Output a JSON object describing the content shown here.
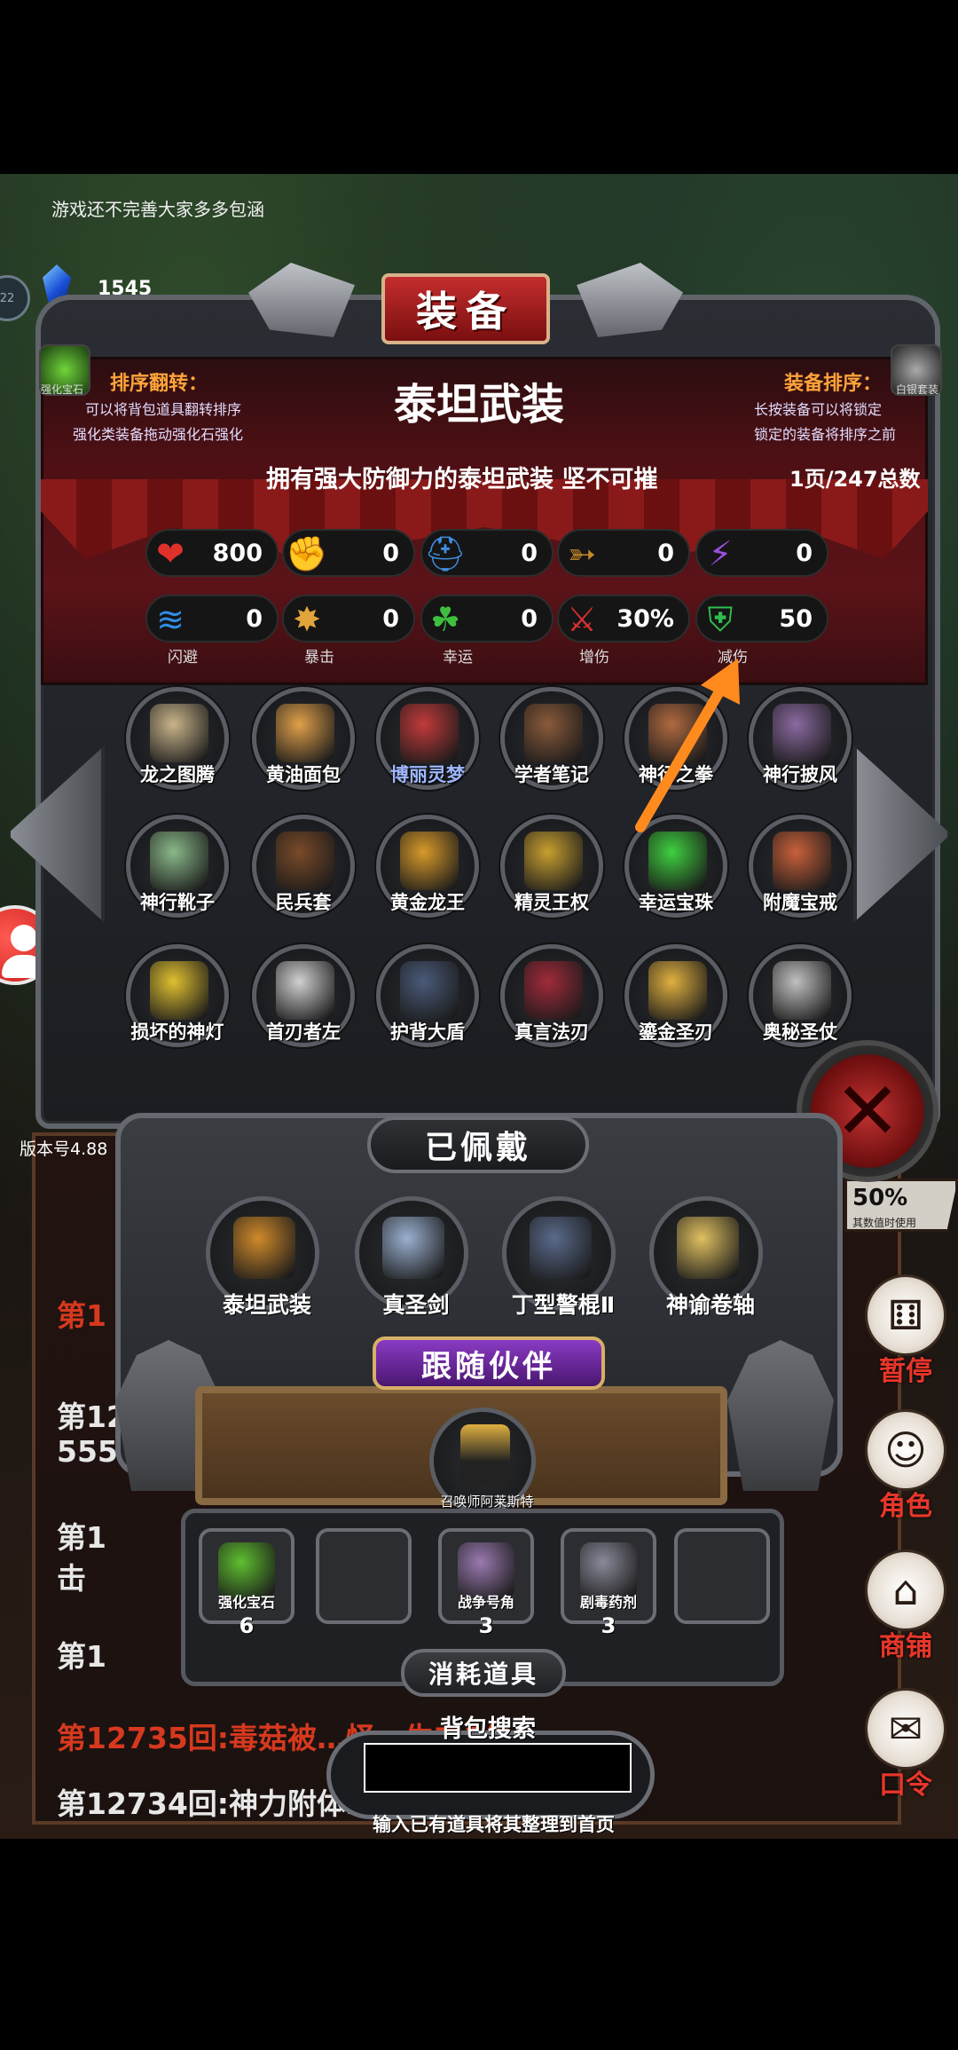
{
  "notice": "游戏还不完善大家多多包涵",
  "currency": {
    "label": "宝石",
    "value": "1545",
    "side_badge": "22"
  },
  "version": "版本号4.88",
  "window_title": "装备",
  "corner_left": {
    "label": "强化宝石"
  },
  "corner_right": {
    "label": "白银套装"
  },
  "hint_left": {
    "title": "排序翻转：",
    "line1": "可以将背包道具翻转排序",
    "line2": "强化类装备拖动强化石强化"
  },
  "hint_right": {
    "title": "装备排序：",
    "line1": "长按装备可以将锁定",
    "line2": "锁定的装备将排序之前"
  },
  "item": {
    "name": "泰坦武装",
    "description": "拥有强大防御力的泰坦武装 坚不可摧",
    "page_info": "1页/247总数"
  },
  "stats_row1": [
    {
      "icon": "heart-icon",
      "value": "800",
      "color": "#e0302a"
    },
    {
      "icon": "muscle-icon",
      "value": "0",
      "color": "#e8c23a"
    },
    {
      "icon": "helmet-icon",
      "value": "0",
      "color": "#3f8de0"
    },
    {
      "icon": "bow-icon",
      "value": "0",
      "color": "#c98a2a"
    },
    {
      "icon": "lightning-icon",
      "value": "0",
      "color": "#9b4fe0"
    }
  ],
  "stats_row2": [
    {
      "icon": "dodge-icon",
      "value": "0",
      "label": "闪避",
      "color": "#2f8de8"
    },
    {
      "icon": "crit-icon",
      "value": "0",
      "label": "暴击",
      "color": "#e0a43a"
    },
    {
      "icon": "clover-icon",
      "value": "0",
      "label": "幸运",
      "color": "#3fbf3f"
    },
    {
      "icon": "crossed-swords-icon",
      "value": "30%",
      "label": "增伤",
      "color": "#d83030"
    },
    {
      "icon": "shield-icon",
      "value": "50",
      "label": "减伤",
      "color": "#2fbf4f"
    }
  ],
  "inventory": [
    {
      "name": "龙之图腾",
      "color": "#c9b48a"
    },
    {
      "name": "黄油面包",
      "color": "#e0a04a"
    },
    {
      "name": "博丽灵梦",
      "color": "#c23a3a",
      "name_color": "#9fb7ff"
    },
    {
      "name": "学者笔记",
      "color": "#8a5a3a"
    },
    {
      "name": "神行之拳",
      "color": "#b06a40"
    },
    {
      "name": "神行披风",
      "color": "#8a6aa0"
    },
    {
      "name": "神行靴子",
      "color": "#8ab88a"
    },
    {
      "name": "民兵套",
      "color": "#7a4a28"
    },
    {
      "name": "黄金龙王",
      "color": "#d89a2a"
    },
    {
      "name": "精灵王权",
      "color": "#c8a030"
    },
    {
      "name": "幸运宝珠",
      "color": "#3fcf3f"
    },
    {
      "name": "附魔宝戒",
      "color": "#c8603a"
    },
    {
      "name": "损坏的神灯",
      "color": "#e0c030"
    },
    {
      "name": "首刃者左",
      "color": "#d0d0d0"
    },
    {
      "name": "护背大盾",
      "color": "#4a5a78"
    },
    {
      "name": "真言法刃",
      "color": "#a02a3a"
    },
    {
      "name": "鎏金圣刃",
      "color": "#e0b040"
    },
    {
      "name": "奥秘圣仗",
      "color": "#c0c0c0"
    }
  ],
  "worn": {
    "title": "已佩戴",
    "items": [
      {
        "name": "泰坦武装",
        "color": "#d08a2a"
      },
      {
        "name": "真圣剑",
        "color": "#9ab0d0"
      },
      {
        "name": "丁型警棍Ⅱ",
        "color": "#5a6a8a"
      },
      {
        "name": "神谕卷轴",
        "color": "#e0c060"
      }
    ]
  },
  "companion": {
    "title": "跟随伙伴",
    "name": "召唤师阿莱斯特"
  },
  "consumables": {
    "title": "消耗道具",
    "items": [
      {
        "name": "强化宝石",
        "qty": "6",
        "color": "#5fbf2f"
      },
      {
        "name": "",
        "qty": "",
        "color": ""
      },
      {
        "name": "战争号角",
        "qty": "3",
        "color": "#9a7ab0"
      },
      {
        "name": "剧毒药剂",
        "qty": "3",
        "color": "#8a8a9a"
      },
      {
        "name": "",
        "qty": "",
        "color": ""
      }
    ]
  },
  "search": {
    "label": "背包搜索",
    "placeholder": "",
    "hint": "输入已有道具将其整理到首页"
  },
  "right_badge": {
    "value": "50%",
    "sub": "其数值时使用"
  },
  "actions": [
    {
      "label": "暂停",
      "icon": "dice-icon",
      "glyph": "⚅"
    },
    {
      "label": "角色",
      "icon": "hooded-figure-icon",
      "glyph": "☺"
    },
    {
      "label": "商铺",
      "icon": "shop-icon",
      "glyph": "⌂"
    },
    {
      "label": "口令",
      "icon": "book-icon",
      "glyph": "✉"
    }
  ],
  "log": {
    "line1": "第1",
    "line2a": "第12",
    "line2b": "555",
    "line3a": "第1",
    "line3b": "击",
    "line4": "第1",
    "line5": "第12735回:毒菇被…怪…生肉1份",
    "line6": "第12734回:神力附体…成4185061"
  }
}
